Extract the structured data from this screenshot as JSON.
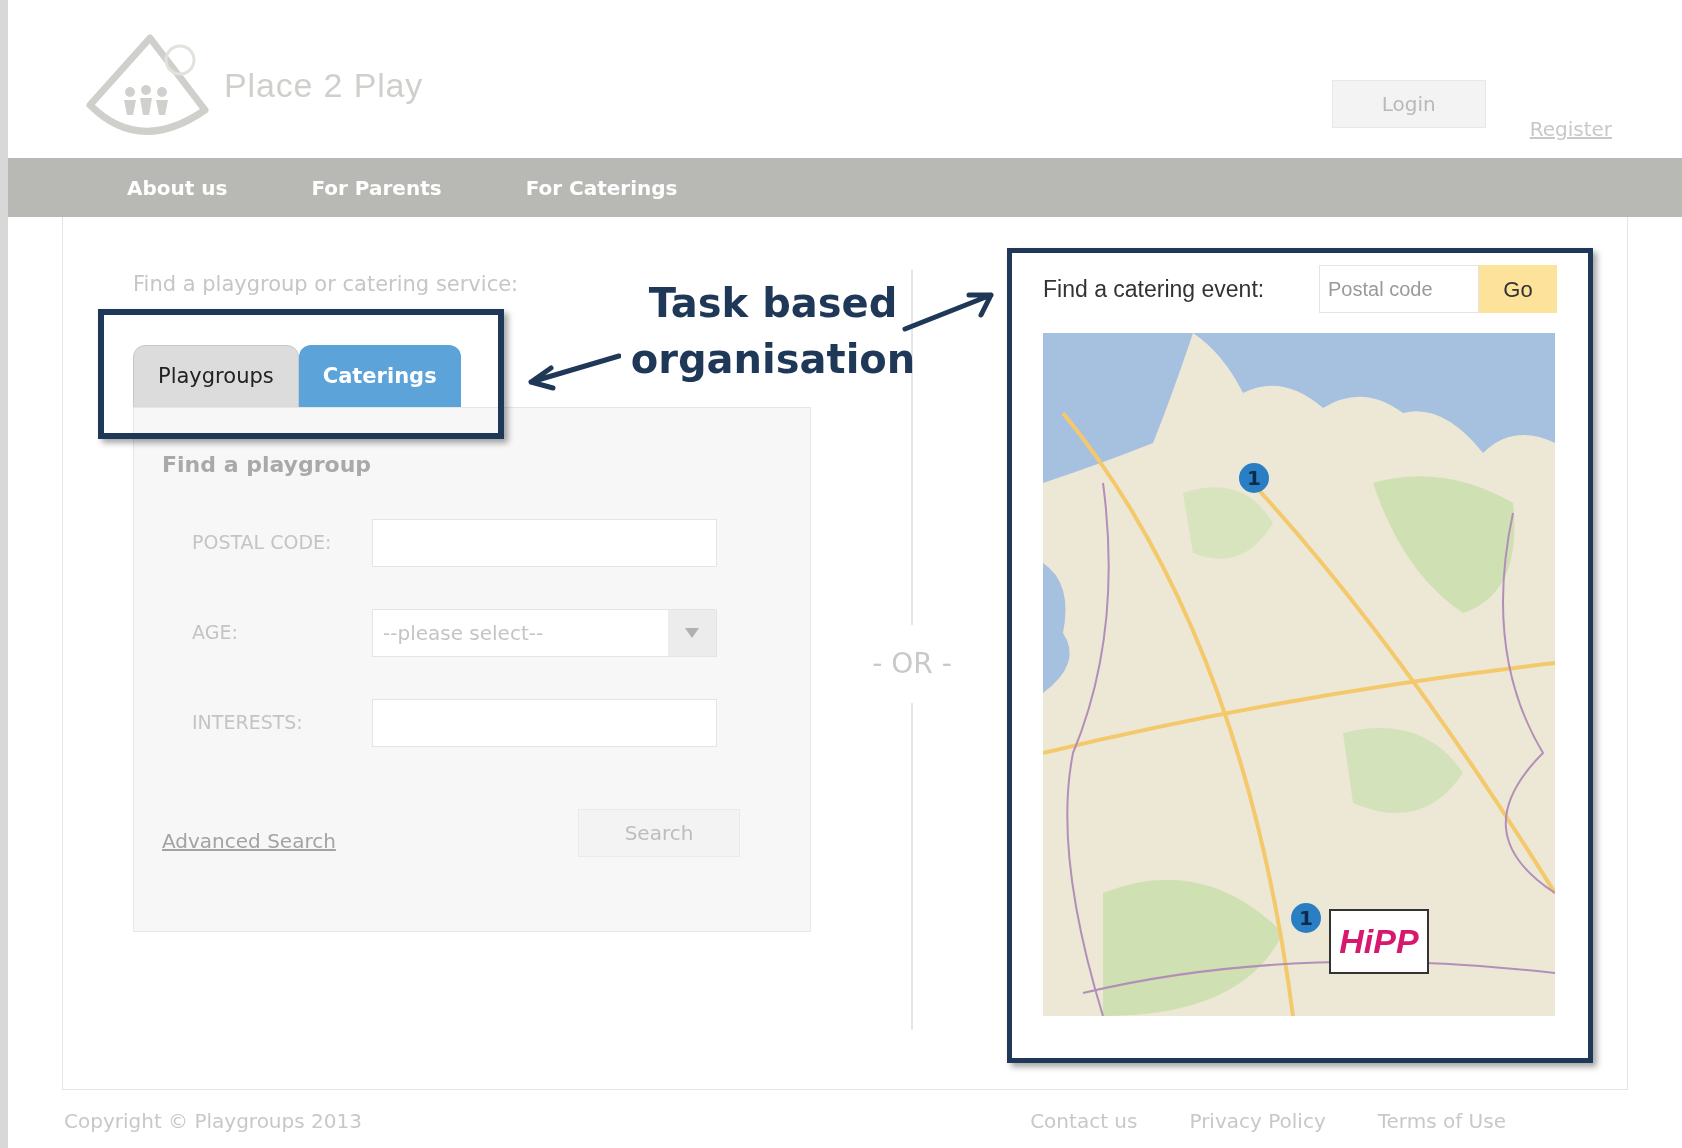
{
  "header": {
    "logo_text": "Place 2 Play",
    "login": "Login",
    "register": "Register"
  },
  "nav": [
    "About us",
    "For Parents",
    "For Caterings"
  ],
  "search": {
    "intro": "Find a playgroup or catering service:",
    "tabs": [
      {
        "label": "Playgroups",
        "selected": false
      },
      {
        "label": "Caterings",
        "selected": true
      }
    ],
    "panel_title": "Find a playgroup",
    "fields": [
      {
        "kind": "text",
        "label": "POSTAL CODE:"
      },
      {
        "kind": "select",
        "label": "AGE:",
        "value": "--please select--"
      },
      {
        "kind": "text",
        "label": "INTERESTS:"
      }
    ],
    "advanced_link": "Advanced Search",
    "search_button": "Search"
  },
  "separator": "- OR -",
  "catering": {
    "label": "Find a catering event:",
    "placeholder": "Postal code",
    "button": "Go",
    "map": {
      "markers": [
        {
          "count": "1"
        },
        {
          "count": "1"
        }
      ],
      "sponsor_logo": "HiPP"
    }
  },
  "annotation": {
    "text": "Task based organisation"
  },
  "footer": {
    "copyright": "Copyright © Playgroups 2013",
    "links": [
      "Contact us",
      "Privacy Policy",
      "Terms of Use"
    ]
  }
}
